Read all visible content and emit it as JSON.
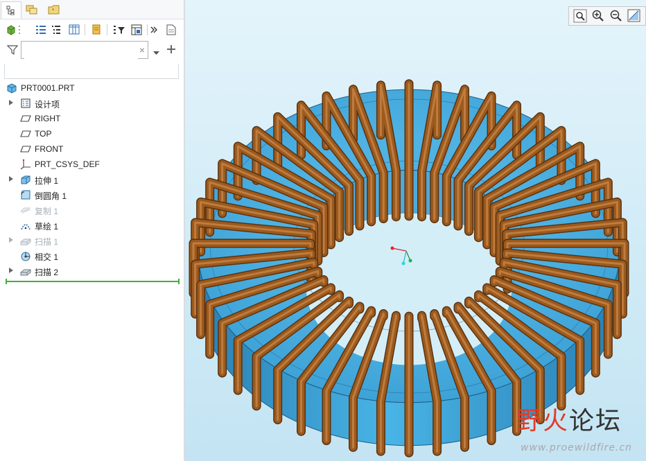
{
  "model_tree": {
    "root": "PRT0001.PRT",
    "items": [
      {
        "label": "设计项",
        "icon": "layers-icon",
        "expandable": true,
        "dimmed": false
      },
      {
        "label": "RIGHT",
        "icon": "datum-plane-icon",
        "expandable": false,
        "dimmed": false
      },
      {
        "label": "TOP",
        "icon": "datum-plane-icon",
        "expandable": false,
        "dimmed": false
      },
      {
        "label": "FRONT",
        "icon": "datum-plane-icon",
        "expandable": false,
        "dimmed": false
      },
      {
        "label": "PRT_CSYS_DEF",
        "icon": "csys-icon",
        "expandable": false,
        "dimmed": false
      },
      {
        "label": "拉伸 1",
        "icon": "extrude-icon",
        "expandable": true,
        "dimmed": false
      },
      {
        "label": "倒圆角 1",
        "icon": "round-icon",
        "expandable": false,
        "dimmed": false
      },
      {
        "label": "复制 1",
        "icon": "copy-icon",
        "expandable": false,
        "dimmed": true
      },
      {
        "label": "草绘 1",
        "icon": "sketch-icon",
        "expandable": false,
        "dimmed": false
      },
      {
        "label": "扫描 1",
        "icon": "sweep-icon",
        "expandable": true,
        "dimmed": true
      },
      {
        "label": "相交 1",
        "icon": "intersect-icon",
        "expandable": false,
        "dimmed": false
      },
      {
        "label": "扫描 2",
        "icon": "sweep-icon",
        "expandable": true,
        "dimmed": false
      }
    ]
  },
  "search": {
    "value": "",
    "placeholder": "",
    "clear_glyph": "×"
  },
  "watermark": {
    "title_a": "野",
    "title_b": "火",
    "title_c": "论坛",
    "url": "www.proewildfire.cn"
  },
  "colors": {
    "core": "#3aa6da",
    "winding": "#9b5a1e",
    "viewport_bg": "#d4eef8",
    "insert_line": "#3fae3f"
  }
}
